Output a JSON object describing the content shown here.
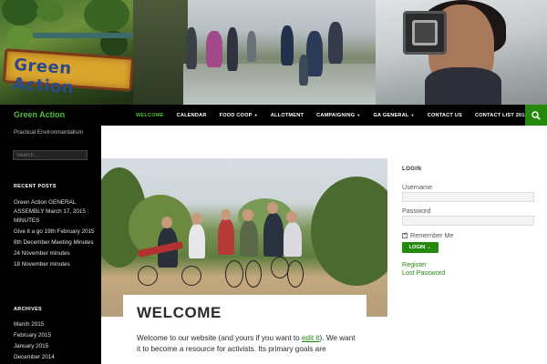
{
  "banner": {
    "sign_text": "Green Action"
  },
  "header": {
    "site_title": "Green Action"
  },
  "nav": {
    "items": [
      {
        "label": "WELCOME",
        "active": true
      },
      {
        "label": "CALENDAR"
      },
      {
        "label": "FOOD COOP",
        "dropdown": true
      },
      {
        "label": "ALLOTMENT"
      },
      {
        "label": "CAMPAIGNING",
        "dropdown": true
      },
      {
        "label": "GA GENERAL",
        "dropdown": true
      },
      {
        "label": "CONTACT US"
      },
      {
        "label": "CONTACT LIST 2014/15"
      }
    ],
    "search_icon": "search-icon"
  },
  "sidebar": {
    "tagline": "Practical Environmentalism",
    "search_placeholder": "Search ...",
    "recent_posts_heading": "RECENT POSTS",
    "recent_posts": [
      "Green Action GENERAL ASSEMBLY March 17, 2015 : MINUTES",
      "Give it a go 19th February 2015",
      "8th December Meeting Minutes",
      "24 November minutes",
      "18 November minutes"
    ],
    "archives_heading": "ARCHIVES",
    "archives": [
      "March 2015",
      "February 2015",
      "January 2015",
      "December 2014"
    ]
  },
  "main": {
    "title": "WELCOME",
    "text_before_link": "Welcome to our website (and yours if you want to ",
    "link_text": "edit it",
    "text_after_link": ").  We want it to become a resource for activists.  Its primary goals are"
  },
  "login": {
    "heading": "LOGIN",
    "username_label": "Username",
    "password_label": "Password",
    "remember_label": "Remember Me",
    "button_label": "LOGIN →",
    "register_link": "Register",
    "lost_password_link": "Lost Password"
  },
  "colors": {
    "accent": "#24890d",
    "title_green": "#52c040",
    "nav_bg": "#000000"
  }
}
